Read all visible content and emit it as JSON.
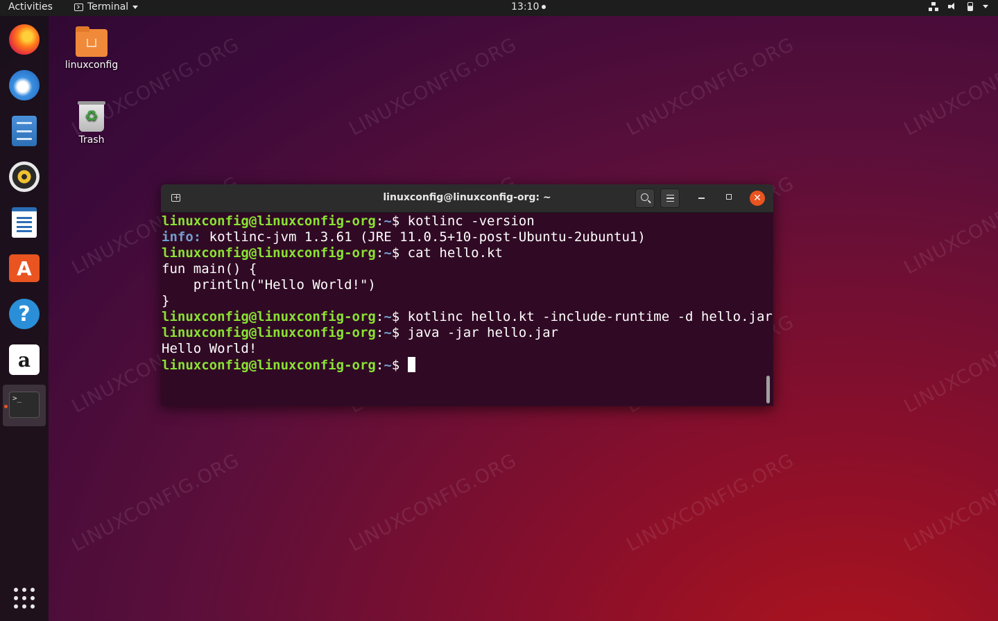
{
  "topbar": {
    "activities": "Activities",
    "app_menu": "Terminal",
    "clock": "13:10"
  },
  "dock": {
    "apps": [
      {
        "name": "Firefox",
        "icon": "firefox-icon"
      },
      {
        "name": "Thunderbird",
        "icon": "thunderbird-icon"
      },
      {
        "name": "Files",
        "icon": "files-icon"
      },
      {
        "name": "Rhythmbox",
        "icon": "rhythmbox-icon"
      },
      {
        "name": "LibreOffice Writer",
        "icon": "writer-icon"
      },
      {
        "name": "Ubuntu Software",
        "icon": "software-icon",
        "glyph": "A"
      },
      {
        "name": "Help",
        "icon": "help-icon",
        "glyph": "?"
      },
      {
        "name": "Amazon",
        "icon": "amazon-icon",
        "glyph": "a"
      },
      {
        "name": "Terminal",
        "icon": "terminal-icon",
        "glyph": ">_"
      }
    ]
  },
  "desktop": {
    "home_folder_label": "linuxconfig",
    "trash_label": "Trash"
  },
  "terminal": {
    "title": "linuxconfig@linuxconfig-org: ~",
    "prompt_user": "linuxconfig@linuxconfig-org",
    "prompt_path": "~",
    "lines": [
      {
        "type": "prompt",
        "cmd": "kotlinc -version"
      },
      {
        "type": "info",
        "label": "info:",
        "text": " kotlinc-jvm 1.3.61 (JRE 11.0.5+10-post-Ubuntu-2ubuntu1)"
      },
      {
        "type": "prompt",
        "cmd": "cat hello.kt"
      },
      {
        "type": "output",
        "text": "fun main() {"
      },
      {
        "type": "output",
        "text": "    println(\"Hello World!\")"
      },
      {
        "type": "output",
        "text": "}"
      },
      {
        "type": "prompt",
        "cmd": "kotlinc hello.kt -include-runtime -d hello.jar"
      },
      {
        "type": "prompt",
        "cmd": "java -jar hello.jar"
      },
      {
        "type": "output",
        "text": "Hello World!"
      },
      {
        "type": "prompt",
        "cmd": "",
        "cursor": true
      }
    ]
  },
  "watermark": "LINUXCONFIG.ORG",
  "colors": {
    "accent": "#e95420",
    "terminal_bg": "#300a24",
    "prompt_user": "#8ae234",
    "prompt_path": "#729fcf"
  }
}
